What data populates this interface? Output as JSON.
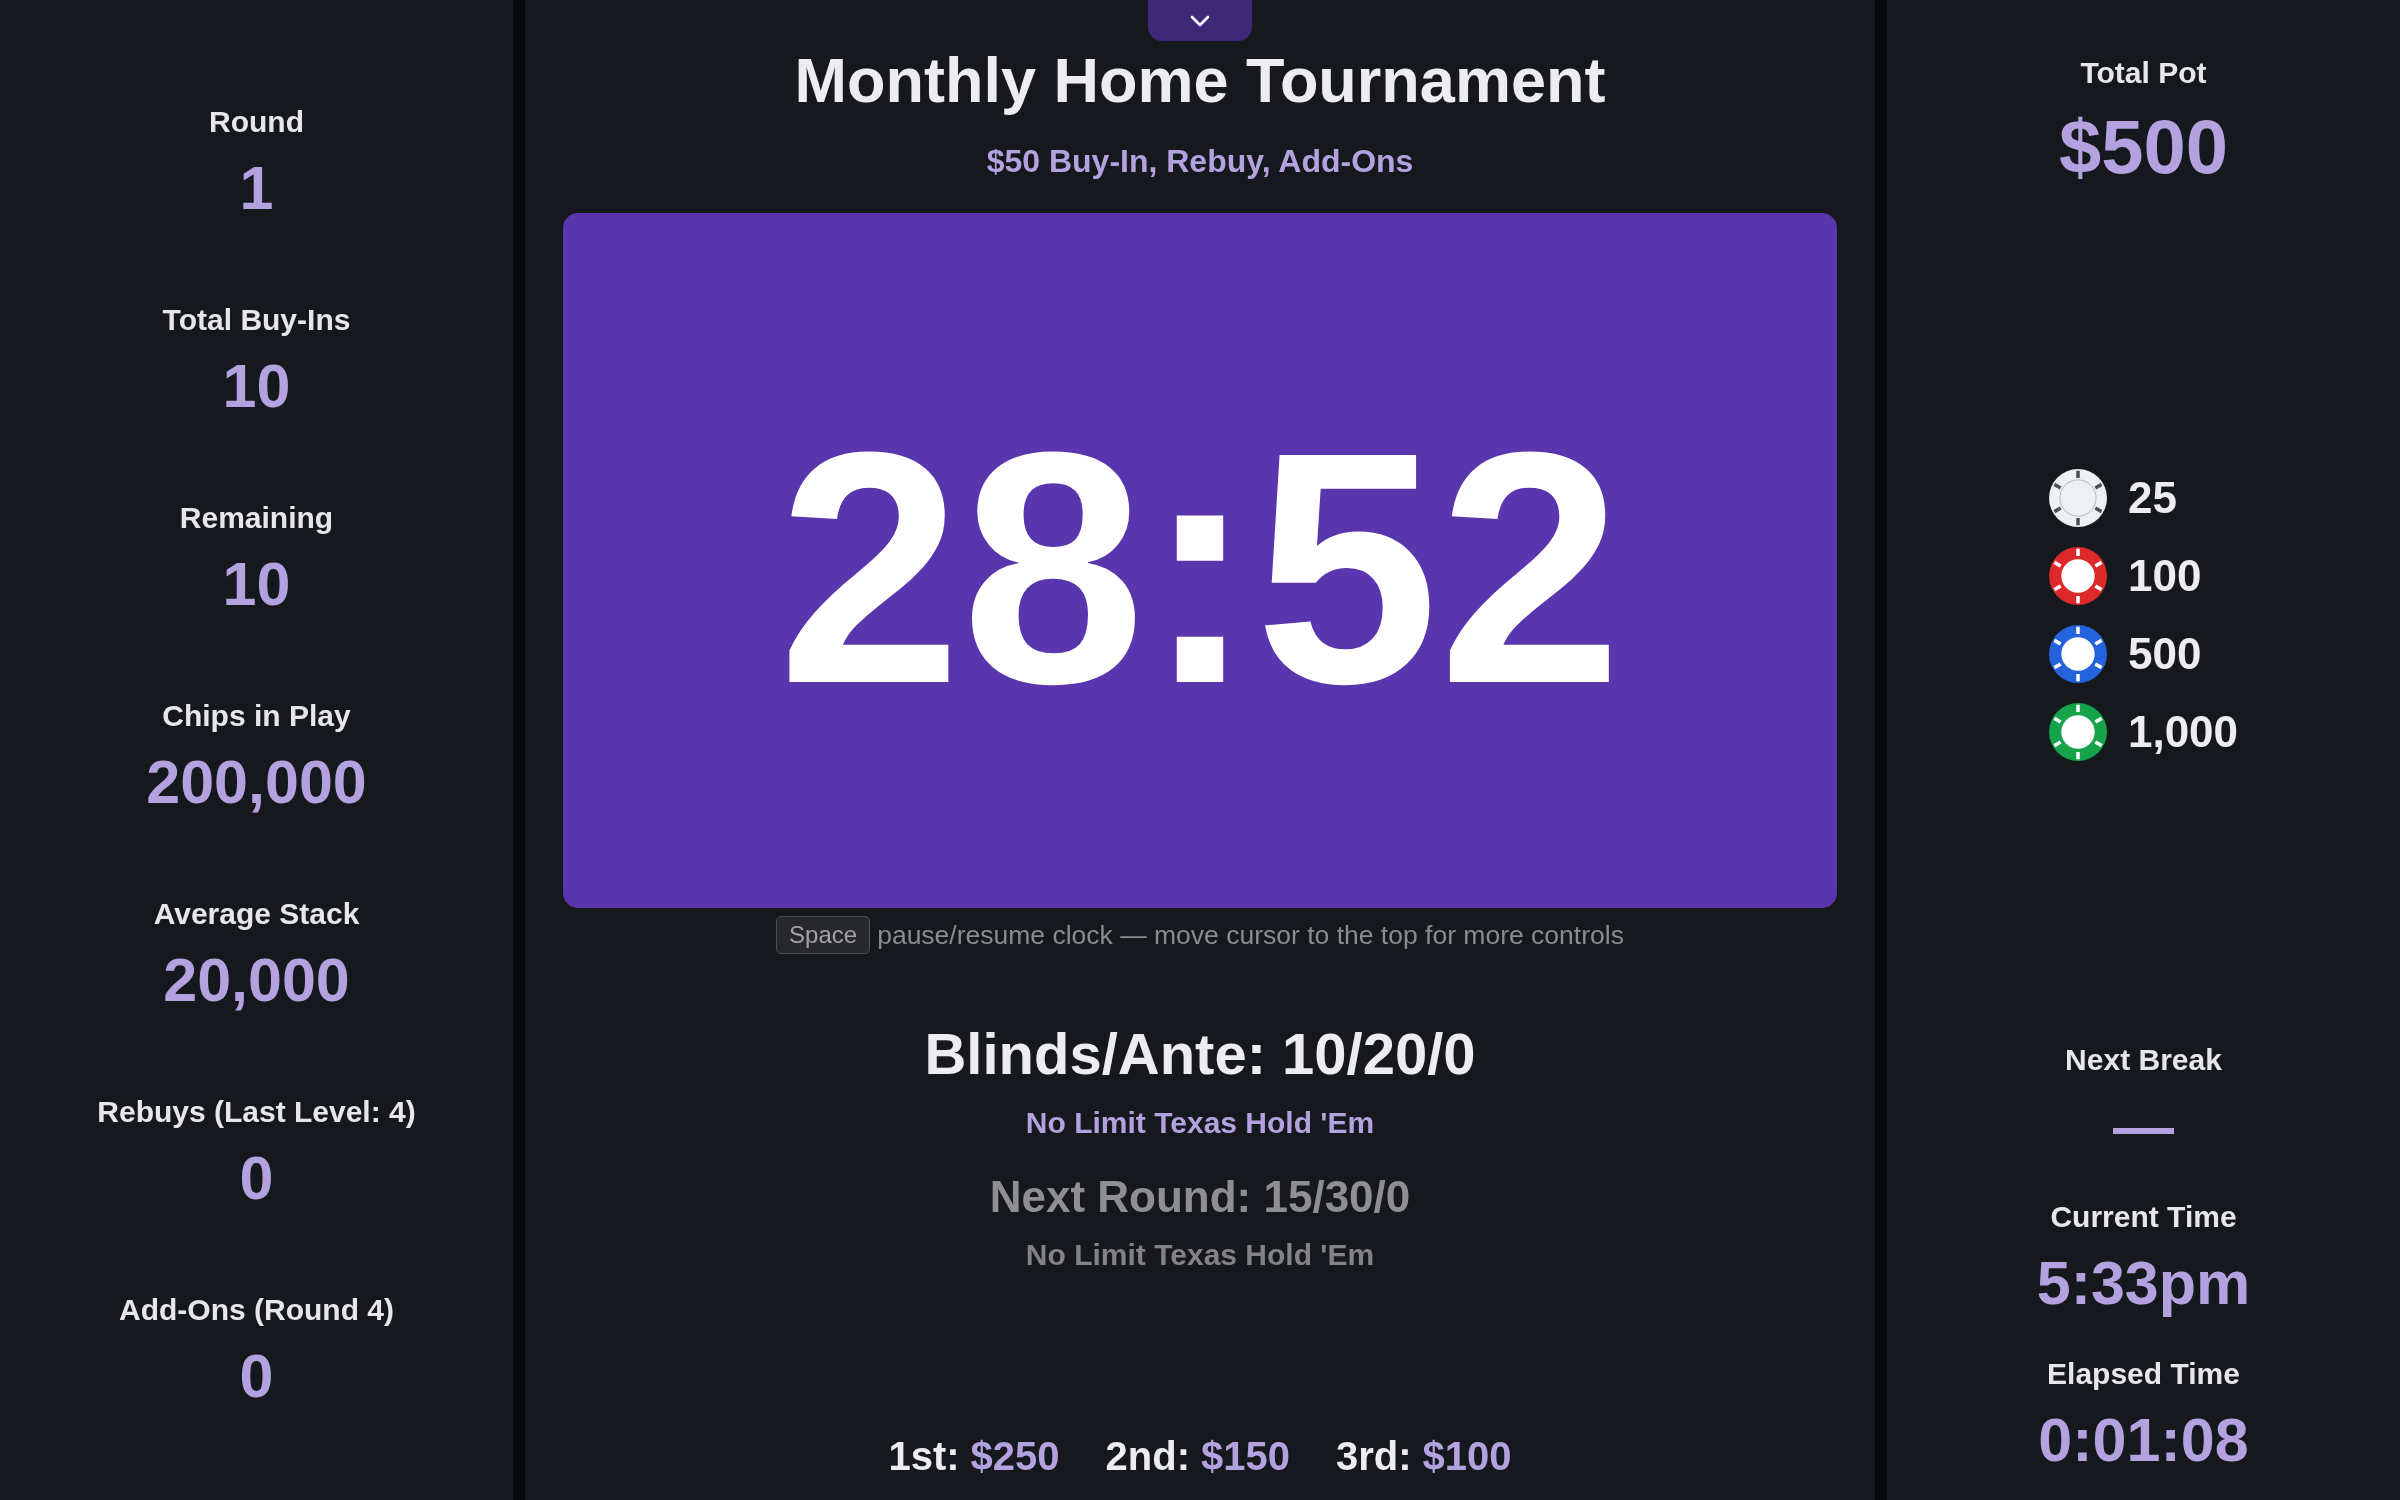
{
  "stats": [
    {
      "label": "Round",
      "value": "1"
    },
    {
      "label": "Total Buy-Ins",
      "value": "10"
    },
    {
      "label": "Remaining",
      "value": "10"
    },
    {
      "label": "Chips in Play",
      "value": "200,000"
    },
    {
      "label": "Average Stack",
      "value": "20,000"
    },
    {
      "label": "Rebuys (Last Level: 4)",
      "value": "0"
    },
    {
      "label": "Add-Ons (Round 4)",
      "value": "0"
    }
  ],
  "title": "Monthly Home Tournament",
  "subtitle": "$50 Buy-In, Rebuy, Add-Ons",
  "clock": {
    "time": "28:52"
  },
  "hint": {
    "key": "Space",
    "text": "pause/resume clock — move cursor to the top for more controls"
  },
  "current_level": {
    "blinds": "Blinds/Ante: 10/20/0",
    "game": "No Limit Texas Hold 'Em"
  },
  "next_level": {
    "blinds": "Next Round: 15/30/0",
    "game": "No Limit Texas Hold 'Em"
  },
  "payouts": [
    {
      "place": "1st:",
      "amount": "$250"
    },
    {
      "place": "2nd:",
      "amount": "$150"
    },
    {
      "place": "3rd:",
      "amount": "$100"
    }
  ],
  "total_pot": {
    "label": "Total Pot",
    "value": "$500"
  },
  "chips": [
    {
      "value": "25",
      "color": "#eef0f3"
    },
    {
      "value": "100",
      "color": "#dc2a2a"
    },
    {
      "value": "500",
      "color": "#2563dc"
    },
    {
      "value": "1,000",
      "color": "#16a34a"
    }
  ],
  "right_stats": [
    {
      "label": "Next Break",
      "value": "—"
    },
    {
      "label": "Current Time",
      "value": "5:33pm"
    },
    {
      "label": "Elapsed Time",
      "value": "0:01:08"
    }
  ]
}
